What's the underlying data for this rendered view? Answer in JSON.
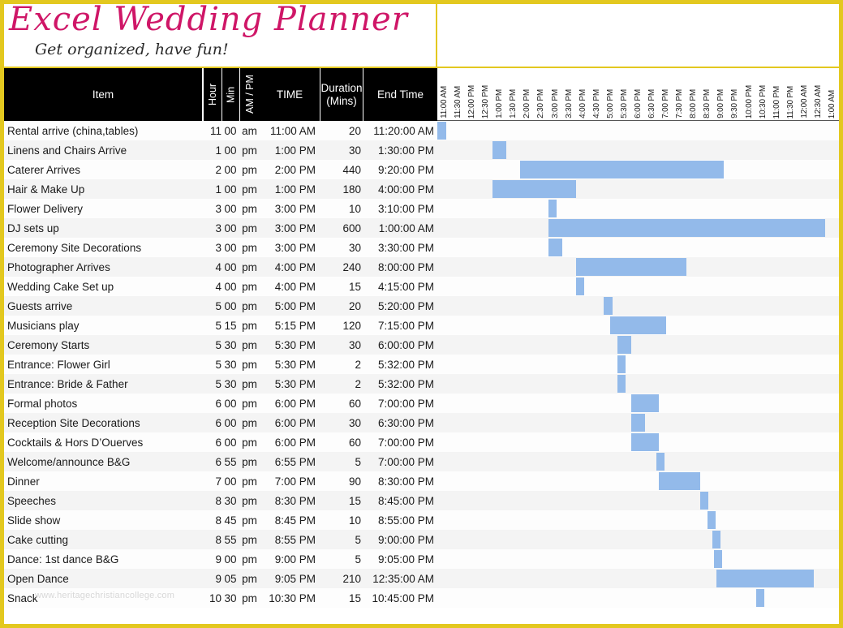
{
  "banner": {
    "title": "Excel Wedding Planner",
    "subtitle": "Get organized, have fun!"
  },
  "watermark": "www.heritagechristiancollege.com",
  "colors": {
    "frame": "#e3c81f",
    "header_bg": "#000000",
    "header_text": "#ffffff",
    "bar": "#93baea",
    "brand": "#cf1667",
    "row_alt": "#f4f4f4"
  },
  "columns": {
    "item": "Item",
    "hour": "Hour",
    "min": "Min",
    "ampm": "AM / PM",
    "time": "TIME",
    "duration": "Duration (Mins)",
    "duration_line1": "Duration",
    "duration_line2": "(Mins)",
    "end_time": "End Time"
  },
  "timeline": {
    "start_label": "11:00 AM",
    "end_label": "1:00 AM",
    "step_minutes": 30,
    "ticks": [
      "11:00 AM",
      "11:30 AM",
      "12:00 PM",
      "12:30 PM",
      "1:00 PM",
      "1:30 PM",
      "2:00 PM",
      "2:30 PM",
      "3:00 PM",
      "3:30 PM",
      "4:00 PM",
      "4:30 PM",
      "5:00 PM",
      "5:30 PM",
      "6:00 PM",
      "6:30 PM",
      "7:00 PM",
      "7:30 PM",
      "8:00 PM",
      "8:30 PM",
      "9:00 PM",
      "9:30 PM",
      "10:00 PM",
      "10:30 PM",
      "11:00 PM",
      "11:30 PM",
      "12:00 AM",
      "12:30 AM",
      "1:00 AM"
    ]
  },
  "rows": [
    {
      "item": "Rental arrive (china,tables)",
      "hour": "11",
      "min": "00",
      "ampm": "am",
      "time": "11:00 AM",
      "duration": "20",
      "end": "11:20:00 AM",
      "start_min": 0,
      "dur_min": 20
    },
    {
      "item": "Linens and Chairs Arrive",
      "hour": "1",
      "min": "00",
      "ampm": "pm",
      "time": "1:00 PM",
      "duration": "30",
      "end": "1:30:00 PM",
      "start_min": 120,
      "dur_min": 30
    },
    {
      "item": "Caterer Arrives",
      "hour": "2",
      "min": "00",
      "ampm": "pm",
      "time": "2:00 PM",
      "duration": "440",
      "end": "9:20:00 PM",
      "start_min": 180,
      "dur_min": 440
    },
    {
      "item": "Hair & Make Up",
      "hour": "1",
      "min": "00",
      "ampm": "pm",
      "time": "1:00 PM",
      "duration": "180",
      "end": "4:00:00 PM",
      "start_min": 120,
      "dur_min": 180
    },
    {
      "item": "Flower Delivery",
      "hour": "3",
      "min": "00",
      "ampm": "pm",
      "time": "3:00 PM",
      "duration": "10",
      "end": "3:10:00 PM",
      "start_min": 240,
      "dur_min": 10
    },
    {
      "item": "DJ sets up",
      "hour": "3",
      "min": "00",
      "ampm": "pm",
      "time": "3:00 PM",
      "duration": "600",
      "end": "1:00:00 AM",
      "start_min": 240,
      "dur_min": 600
    },
    {
      "item": "Ceremony Site Decorations",
      "hour": "3",
      "min": "00",
      "ampm": "pm",
      "time": "3:00 PM",
      "duration": "30",
      "end": "3:30:00 PM",
      "start_min": 240,
      "dur_min": 30
    },
    {
      "item": "Photographer Arrives",
      "hour": "4",
      "min": "00",
      "ampm": "pm",
      "time": "4:00 PM",
      "duration": "240",
      "end": "8:00:00 PM",
      "start_min": 300,
      "dur_min": 240
    },
    {
      "item": "Wedding Cake Set up",
      "hour": "4",
      "min": "00",
      "ampm": "pm",
      "time": "4:00 PM",
      "duration": "15",
      "end": "4:15:00 PM",
      "start_min": 300,
      "dur_min": 15
    },
    {
      "item": "Guests arrive",
      "hour": "5",
      "min": "00",
      "ampm": "pm",
      "time": "5:00 PM",
      "duration": "20",
      "end": "5:20:00 PM",
      "start_min": 360,
      "dur_min": 20
    },
    {
      "item": "Musicians play",
      "hour": "5",
      "min": "15",
      "ampm": "pm",
      "time": "5:15 PM",
      "duration": "120",
      "end": "7:15:00 PM",
      "start_min": 375,
      "dur_min": 120
    },
    {
      "item": "Ceremony Starts",
      "hour": "5",
      "min": "30",
      "ampm": "pm",
      "time": "5:30 PM",
      "duration": "30",
      "end": "6:00:00 PM",
      "start_min": 390,
      "dur_min": 30
    },
    {
      "item": "Entrance: Flower Girl",
      "hour": "5",
      "min": "30",
      "ampm": "pm",
      "time": "5:30 PM",
      "duration": "2",
      "end": "5:32:00 PM",
      "start_min": 390,
      "dur_min": 2
    },
    {
      "item": "Entrance: Bride & Father",
      "hour": "5",
      "min": "30",
      "ampm": "pm",
      "time": "5:30 PM",
      "duration": "2",
      "end": "5:32:00 PM",
      "start_min": 390,
      "dur_min": 2
    },
    {
      "item": "Formal photos",
      "hour": "6",
      "min": "00",
      "ampm": "pm",
      "time": "6:00 PM",
      "duration": "60",
      "end": "7:00:00 PM",
      "start_min": 420,
      "dur_min": 60
    },
    {
      "item": "Reception Site Decorations",
      "hour": "6",
      "min": "00",
      "ampm": "pm",
      "time": "6:00 PM",
      "duration": "30",
      "end": "6:30:00 PM",
      "start_min": 420,
      "dur_min": 30
    },
    {
      "item": "Cocktails & Hors D’Ouerves",
      "hour": "6",
      "min": "00",
      "ampm": "pm",
      "time": "6:00 PM",
      "duration": "60",
      "end": "7:00:00 PM",
      "start_min": 420,
      "dur_min": 60
    },
    {
      "item": "Welcome/announce B&G",
      "hour": "6",
      "min": "55",
      "ampm": "pm",
      "time": "6:55 PM",
      "duration": "5",
      "end": "7:00:00 PM",
      "start_min": 475,
      "dur_min": 5
    },
    {
      "item": "Dinner",
      "hour": "7",
      "min": "00",
      "ampm": "pm",
      "time": "7:00 PM",
      "duration": "90",
      "end": "8:30:00 PM",
      "start_min": 480,
      "dur_min": 90
    },
    {
      "item": "Speeches",
      "hour": "8",
      "min": "30",
      "ampm": "pm",
      "time": "8:30 PM",
      "duration": "15",
      "end": "8:45:00 PM",
      "start_min": 570,
      "dur_min": 15
    },
    {
      "item": "Slide show",
      "hour": "8",
      "min": "45",
      "ampm": "pm",
      "time": "8:45 PM",
      "duration": "10",
      "end": "8:55:00 PM",
      "start_min": 585,
      "dur_min": 10
    },
    {
      "item": "Cake cutting",
      "hour": "8",
      "min": "55",
      "ampm": "pm",
      "time": "8:55 PM",
      "duration": "5",
      "end": "9:00:00 PM",
      "start_min": 595,
      "dur_min": 5
    },
    {
      "item": "Dance: 1st dance B&G",
      "hour": "9",
      "min": "00",
      "ampm": "pm",
      "time": "9:00 PM",
      "duration": "5",
      "end": "9:05:00 PM",
      "start_min": 600,
      "dur_min": 5
    },
    {
      "item": "Open Dance",
      "hour": "9",
      "min": "05",
      "ampm": "pm",
      "time": "9:05 PM",
      "duration": "210",
      "end": "12:35:00 AM",
      "start_min": 605,
      "dur_min": 210
    },
    {
      "item": "Snack",
      "hour": "10",
      "min": "30",
      "ampm": "pm",
      "time": "10:30 PM",
      "duration": "15",
      "end": "10:45:00 PM",
      "start_min": 690,
      "dur_min": 15
    }
  ]
}
